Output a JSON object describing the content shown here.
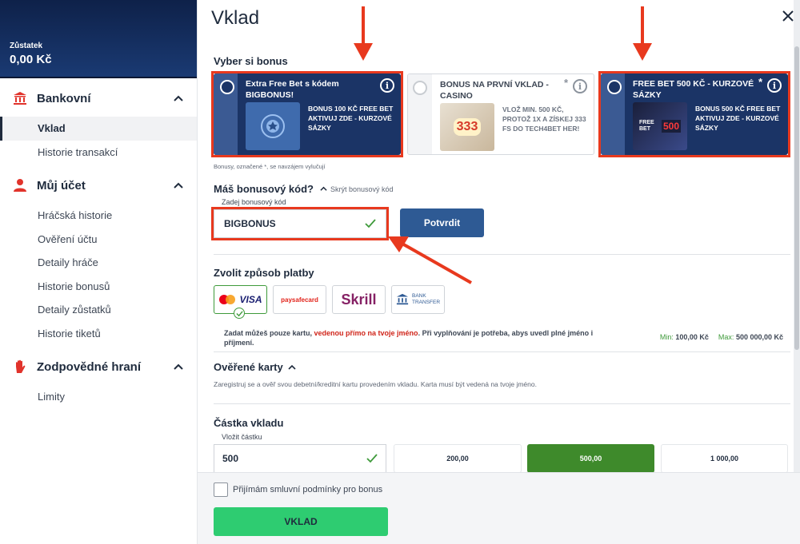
{
  "sidebar": {
    "balance_label": "Zůstatek",
    "balance_value": "0,00 Kč",
    "sections": [
      {
        "title": "Bankovní",
        "icon": "bank-icon",
        "items": [
          "Vklad",
          "Historie transakcí"
        ]
      },
      {
        "title": "Můj účet",
        "icon": "user-icon",
        "items": [
          "Hráčská historie",
          "Ověření účtu",
          "Detaily hráče",
          "Historie bonusů",
          "Detaily zůstatků",
          "Historie tiketů"
        ]
      },
      {
        "title": "Zodpovědné hraní",
        "icon": "hand-icon",
        "items": [
          "Limity"
        ]
      }
    ]
  },
  "main": {
    "title": "Vklad",
    "bonus_section_title": "Vyber si bonus",
    "cards": [
      {
        "title": "Extra Free Bet s kódem BIGBONUS!",
        "desc": "BONUS 100 KČ FREE BET AKTIVUJ ZDE - KURZOVÉ SÁZKY",
        "star": ""
      },
      {
        "title": "BONUS NA PRVNÍ VKLAD - CASINO",
        "desc": "VLOŽ MIN. 500 KČ, PROTOŽ 1X A ZÍSKEJ 333 FS DO TECH4BET HER!",
        "star": "*"
      },
      {
        "title": "FREE BET 500 KČ - KURZOVÉ SÁZKY",
        "desc": "BONUS 500 KČ FREE BET AKTIVUJ ZDE - KURZOVÉ SÁZKY",
        "star": "*"
      }
    ],
    "card_image_texts": [
      "333",
      "FREE BET",
      "500"
    ],
    "exclusive_note": "Bonusy, označené *, se navzájem vylučují",
    "bonus_code_label": "Máš bonusový kód?",
    "hide_code_label": "Skrýt bonusový kód",
    "code_input_label": "Zadej bonusový kód",
    "code_value": "BIGBONUS",
    "confirm_label": "Potvrdit",
    "payment_title": "Zvolit způsob platby",
    "payment_methods": [
      {
        "name": "VISA",
        "sub": "",
        "selected": true
      },
      {
        "name": "paysafecard",
        "sub": "",
        "selected": false
      },
      {
        "name": "Skrill",
        "sub": "",
        "selected": false
      },
      {
        "name": "BANK",
        "sub": "TRANSFER",
        "selected": false
      }
    ],
    "note_part1": "Zadat můžeš pouze kartu, ",
    "note_red": "vedenou přímo na tvoje jméno",
    "note_part2": ". Při vyplňování je potřeba, abys uvedl plné jméno i příjmení.",
    "min_label": "Min:",
    "min_value": "100,00 Kč",
    "max_label": "Max:",
    "max_value": "500 000,00 Kč",
    "verified_title": "Ověřené karty",
    "verified_desc": "Zaregistruj se a ověř svou debetní/kreditní kartu provedením vkladu. Karta musí být vedená na tvoje jméno.",
    "amount_title": "Částka vkladu",
    "amount_input_label": "Vložit částku",
    "amount_value": "500",
    "amount_options": [
      "200,00",
      "500,00",
      "1 000,00"
    ],
    "selected_amount_index": 1,
    "terms_label": "Přijímám smluvní podmínky pro bonus",
    "submit_label": "VKLAD"
  },
  "colors": {
    "highlight": "#e8391e",
    "navy": "#1b3466",
    "green_button": "#2ecc71",
    "selected_amount": "#3e8a2b",
    "note_red": "#d0251a"
  }
}
